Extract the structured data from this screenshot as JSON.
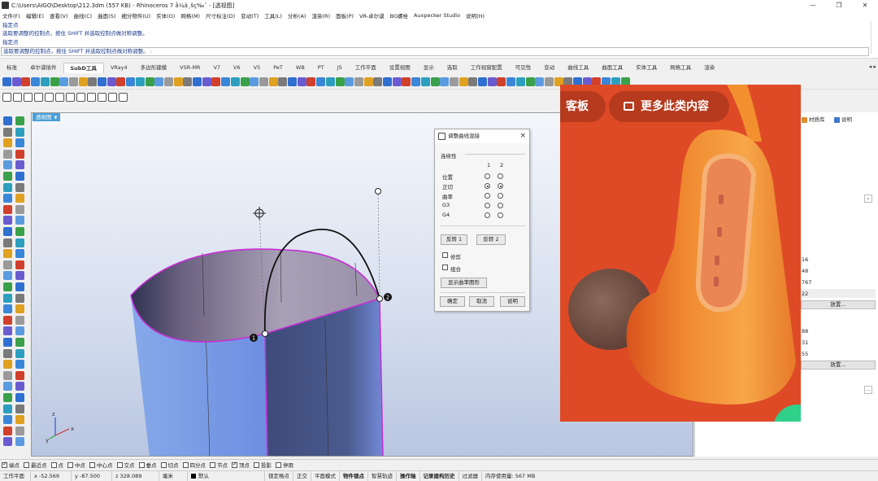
{
  "window": {
    "title": "C:\\Users\\AIGO\\Desktop\\212.3dm (557 KB) - Rhinoceros 7 å¼ä¸šç‰ˆ - [透视图]",
    "minimize": "—",
    "maximize": "❐",
    "close": "✕"
  },
  "menu": [
    "文件(F)",
    "编辑(E)",
    "查看(V)",
    "曲线(C)",
    "曲面(S)",
    "细分物件(U)",
    "实体(O)",
    "网格(M)",
    "尺寸标注(D)",
    "变动(T)",
    "工具(L)",
    "分析(A)",
    "渲染(R)",
    "面板(P)",
    "VR-卓尔谟",
    "BG螺栓",
    "Auxpecker Studio",
    "说明(H)"
  ],
  "command": {
    "history": [
      "指定点",
      "选取要调整的控制点，按住 SHIFT 并选取控制点做对称调整。",
      "指定点"
    ],
    "prompt": "选取要调整的控制点，按住 SHIFT 并选取控制点做对称调整。 :"
  },
  "tabs": [
    "标准",
    "卓尔谟插件",
    "SubD工具",
    "VRay4",
    "多边形建模",
    "VSR-MR",
    "V7",
    "V6",
    "V5",
    "PeT",
    "WB",
    "PT",
    "JS",
    "工作平面",
    "设置视图",
    "显示",
    "选取",
    "工作视窗配置",
    "可见性",
    "变动",
    "曲线工具",
    "曲面工具",
    "实体工具",
    "网格工具",
    "渲染"
  ],
  "tabs_active_index": 2,
  "tab_scroll": "◂ ▸",
  "viewport": {
    "label": "透视图",
    "point_labels": [
      "1",
      "2"
    ],
    "axis_labels": [
      "x",
      "y",
      "z"
    ]
  },
  "dialog": {
    "title": "调整曲线混接",
    "close": "×",
    "section": "连续性",
    "col_headers": [
      "1",
      "2"
    ],
    "rows": [
      {
        "label": "位置",
        "c1": false,
        "c2": false
      },
      {
        "label": "正切",
        "c1": true,
        "c2": true
      },
      {
        "label": "曲率",
        "c1": false,
        "c2": false
      },
      {
        "label": "G3",
        "c1": false,
        "c2": false
      },
      {
        "label": "G4",
        "c1": false,
        "c2": false
      }
    ],
    "flip1": "反转 1",
    "flip2": "反转 2",
    "trim": "修剪",
    "join": "组合",
    "show_curvature": "显示曲率图形",
    "ok": "确定",
    "cancel": "取消",
    "help": "说明"
  },
  "right_panel": {
    "tabs": [
      "材质库",
      "说明"
    ],
    "values": [
      "16",
      "48",
      "767",
      "22",
      "88",
      "31",
      "55"
    ],
    "button1": "放置...",
    "button2": "放置...",
    "dropdown": "⌄",
    "more": "..."
  },
  "photo": {
    "pill1_text": "客板",
    "pill2_text": "更多此类内容",
    "colors": {
      "background": "#de4a26",
      "pill": "#b63a1e",
      "earbud_orange": "#f59a3c",
      "accent_green": "#2ed08a"
    }
  },
  "snaps": [
    {
      "label": "端点",
      "on": true
    },
    {
      "label": "最近点",
      "on": false
    },
    {
      "label": "点",
      "on": false
    },
    {
      "label": "中点",
      "on": false
    },
    {
      "label": "中心点",
      "on": false
    },
    {
      "label": "交点",
      "on": false
    },
    {
      "label": "垂点",
      "on": false
    },
    {
      "label": "切点",
      "on": false
    },
    {
      "label": "四分点",
      "on": false
    },
    {
      "label": "节点",
      "on": false
    },
    {
      "label": "顶点",
      "on": true
    },
    {
      "label": "投影",
      "on": false
    },
    {
      "label": "停用",
      "on": false
    }
  ],
  "status": {
    "cplane": "工作平面",
    "x": "x -52.569",
    "y": "y -87.500",
    "z": "z 328.089",
    "unit": "毫米",
    "layer": "默认",
    "grid_snap": "锁定格点",
    "ortho": "正交",
    "planar": "平面模式",
    "osnap": "物件锁点",
    "smarttrack": "智慧轨迹",
    "gumball": "操作轴",
    "history": "记录建构历史",
    "filter": "过滤器",
    "memory": "内存使用量: 567 MB"
  }
}
